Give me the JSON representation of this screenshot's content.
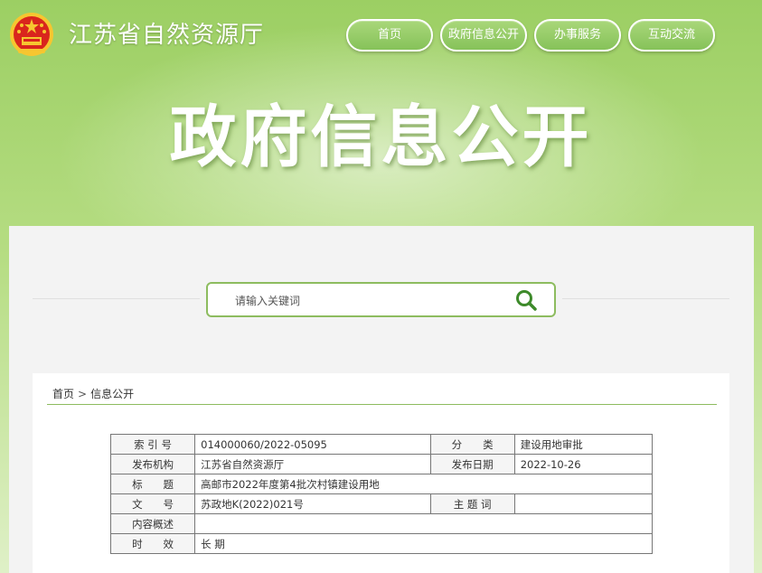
{
  "header": {
    "site_title": "江苏省自然资源厅",
    "nav": [
      "首页",
      "政府信息公开",
      "办事服务",
      "互动交流"
    ],
    "hero_title": "政府信息公开"
  },
  "search": {
    "placeholder": "请输入关键词"
  },
  "breadcrumb": {
    "home": "首页",
    "sep": ">",
    "current": "信息公开"
  },
  "meta": {
    "index_no_label": "索 引 号",
    "index_no": "014000060/2022-05095",
    "category_label": "分　　类",
    "category": "建设用地审批",
    "publisher_label": "发布机构",
    "publisher": "江苏省自然资源厅",
    "date_label": "发布日期",
    "date": "2022-10-26",
    "title_label": "标　　题",
    "title": "高邮市2022年度第4批次村镇建设用地",
    "doc_no_label": "文　　号",
    "doc_no": "苏政地K(2022)021号",
    "subject_label": "主 题 词",
    "subject": "",
    "summary_label": "内容概述",
    "summary": "",
    "validity_label": "时　　效",
    "validity": "长 期"
  },
  "colors": {
    "accent_green": "#8dbc5f",
    "emblem_red": "#d9251d",
    "emblem_gold": "#f6c630"
  }
}
